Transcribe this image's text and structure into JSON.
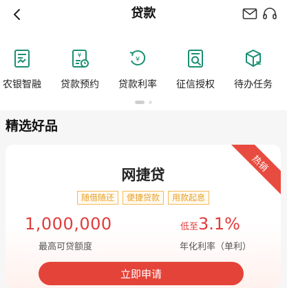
{
  "header": {
    "title": "贷款"
  },
  "quick_menu": [
    {
      "label": "农银智融",
      "icon": "report-chart-icon"
    },
    {
      "label": "贷款预约",
      "icon": "loan-appointment-icon"
    },
    {
      "label": "贷款利率",
      "icon": "interest-rate-icon"
    },
    {
      "label": "征信授权",
      "icon": "credit-check-icon"
    },
    {
      "label": "待办任务",
      "icon": "task-box-icon"
    }
  ],
  "section": {
    "title": "精选好品"
  },
  "product": {
    "badge": "热销",
    "name": "网捷贷",
    "tags": [
      "随借随还",
      "便捷贷款",
      "用款起息"
    ],
    "amount": "1,000,000",
    "amount_label": "最高可贷额度",
    "rate_prefix": "低至",
    "rate": "3.1%",
    "rate_label": "年化利率（单利）",
    "apply_label": "立即申请"
  },
  "colors": {
    "accent": "#e44339",
    "tag": "#f3b95a",
    "icon": "#1a8f72"
  }
}
